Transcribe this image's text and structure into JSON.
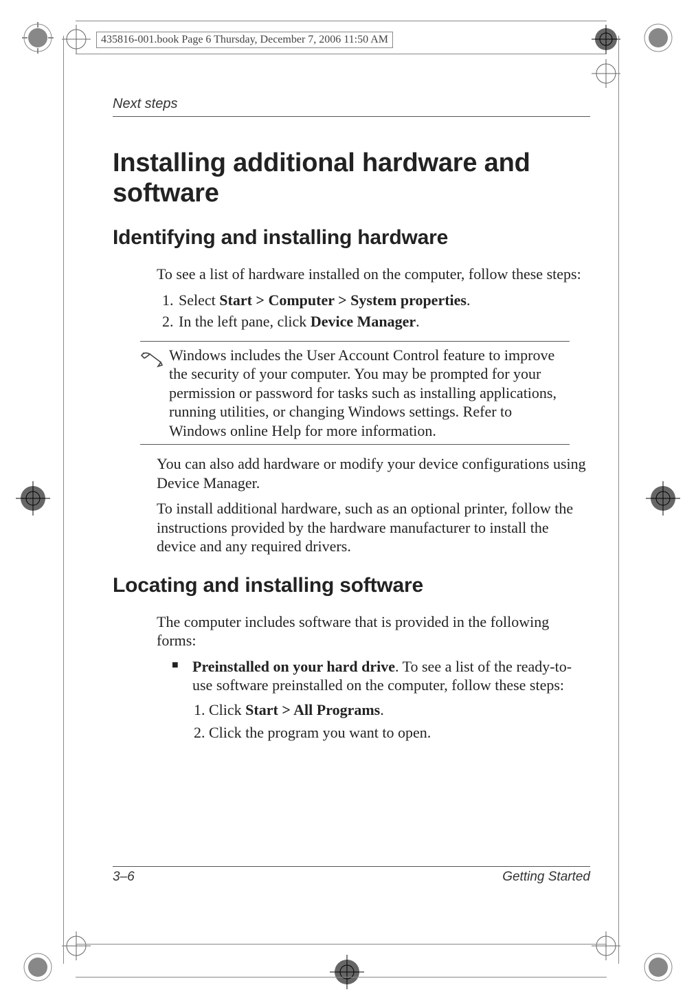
{
  "crop_header": "435816-001.book  Page 6  Thursday, December 7, 2006  11:50 AM",
  "running_header": "Next steps",
  "h1": "Installing additional hardware and software",
  "h2a": "Identifying and installing hardware",
  "p1": "To see a list of hardware installed on the computer, follow these steps:",
  "step1_pre": "Select ",
  "step1_bold": "Start > Computer > System properties",
  "step1_post": ".",
  "step2_pre": "In the left pane, click ",
  "step2_bold": "Device Manager",
  "step2_post": ".",
  "note": "Windows includes the User Account Control feature to improve the security of your computer. You may be prompted for your permission or password for tasks such as installing applications, running utilities, or changing Windows settings. Refer to Windows online Help for more information.",
  "p2": "You can also add hardware or modify your device configurations using Device Manager.",
  "p3": "To install additional hardware, such as an optional printer, follow the instructions provided by the hardware manufacturer to install the device and any required drivers.",
  "h2b": "Locating and installing software",
  "p4": "The computer includes software that is provided in the following forms:",
  "bullet1_bold": "Preinstalled on your hard drive",
  "bullet1_rest": ". To see a list of the ready-to-use software preinstalled on the computer, follow these steps:",
  "sub1_pre": "Click ",
  "sub1_bold": "Start > All Programs",
  "sub1_post": ".",
  "sub2": "Click the program you want to open.",
  "footer_left": "3–6",
  "footer_right": "Getting Started"
}
